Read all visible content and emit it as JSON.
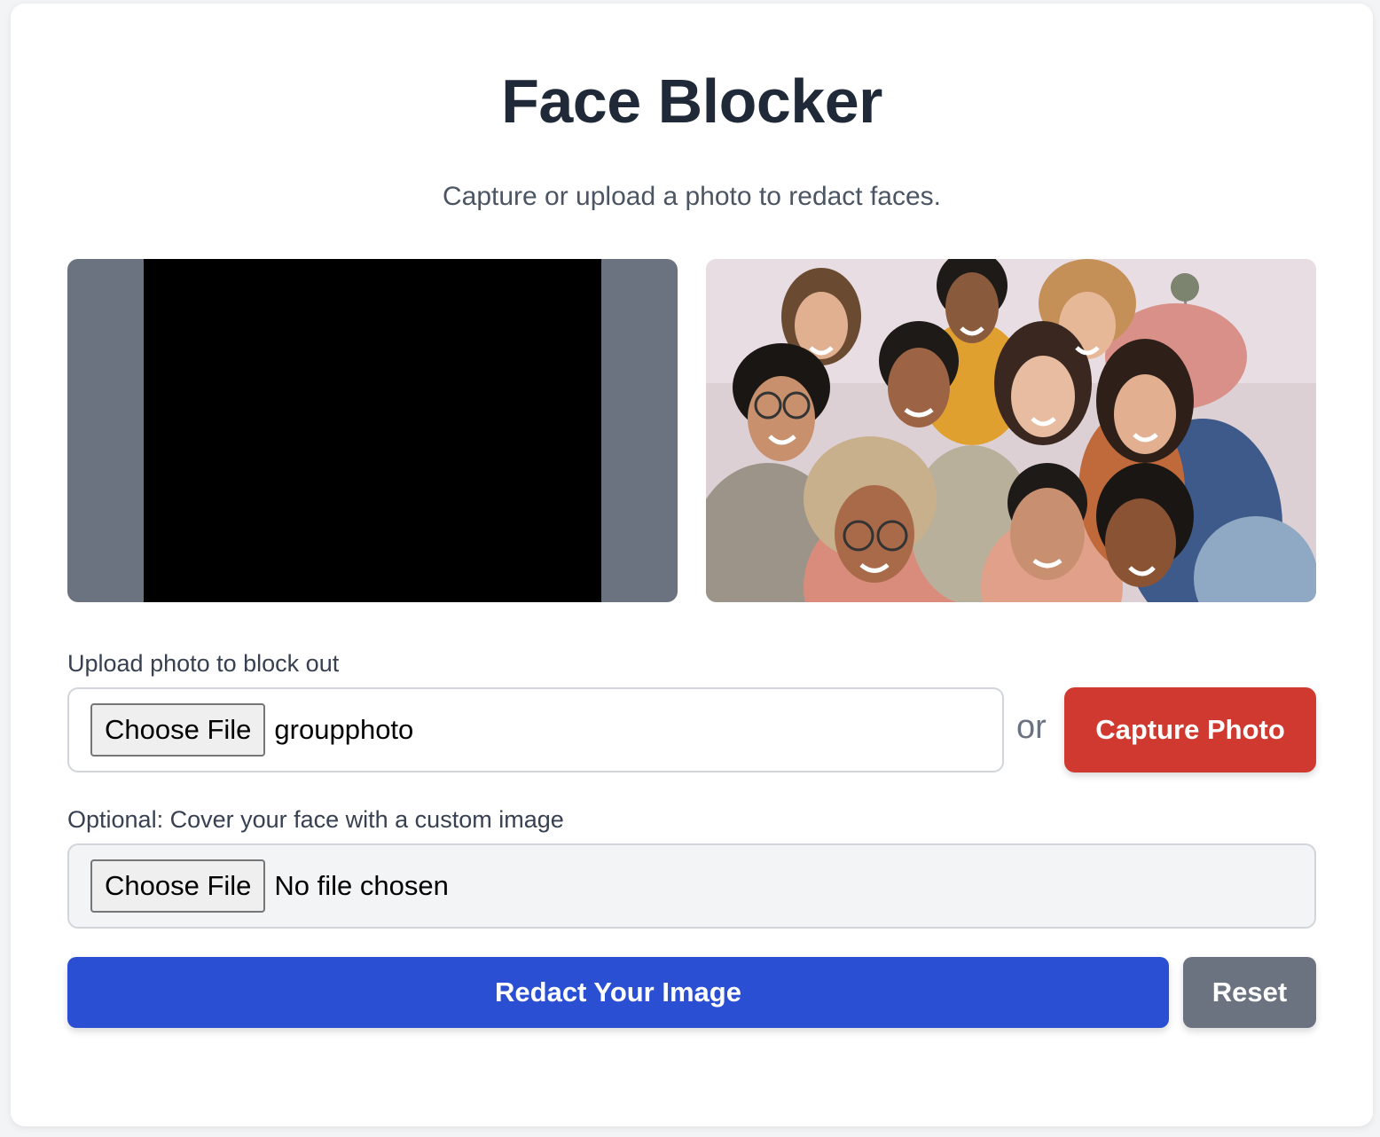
{
  "header": {
    "title": "Face Blocker",
    "subtitle": "Capture or upload a photo to redact faces."
  },
  "preview": {
    "camera_feed": "camera-feed",
    "photo": "group-photo-preview"
  },
  "upload": {
    "label": "Upload photo to block out",
    "choose_label": "Choose File",
    "file_name": "groupphoto",
    "or_text": "or",
    "capture_label": "Capture Photo"
  },
  "custom_image": {
    "label": "Optional: Cover your face with a custom image",
    "choose_label": "Choose File",
    "file_name": "No file chosen"
  },
  "actions": {
    "redact_label": "Redact Your Image",
    "reset_label": "Reset"
  },
  "colors": {
    "primary": "#2b4fd3",
    "danger": "#d0392f",
    "secondary": "#6b7280",
    "title": "#1f2937"
  }
}
